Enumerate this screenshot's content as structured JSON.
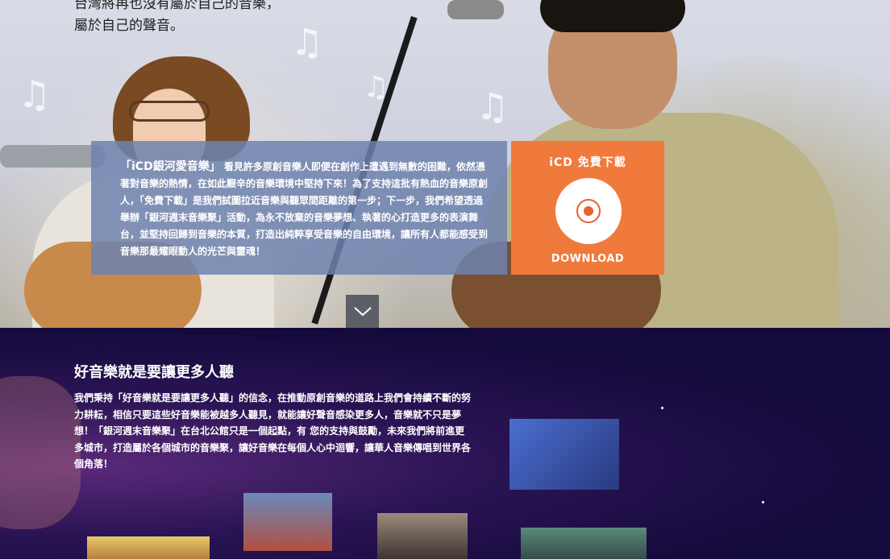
{
  "hero": {
    "text_line1": "台灣將再也沒有屬於自己的音樂，",
    "text_line2": "屬於自己的聲音。",
    "info_lead": "「iCD銀河愛音樂」",
    "info_body": "看見許多原創音樂人即便在創作上遭遇到無數的困難，依然憑著對音樂的熱情，在如此艱辛的音樂環境中堅持下來！為了支持這批有熱血的音樂原創人，「免費下載」是我們試圖拉近音樂與聽眾間距離的第一步；下一步，我們希望透過舉辦「銀河週末音樂聚」活動，為永不放棄的音樂夢想、執著的心打造更多的表演舞台，並堅持回歸到音樂的本質，打造出純粹享受音樂的自由環境，讓所有人都能感受到音樂那最耀眼動人的光芒與靈魂！",
    "download_title": "iCD 免費下載",
    "download_label": "DOWNLOAD",
    "music_note_glyph": "♫"
  },
  "section": {
    "title": "好音樂就是要讓更多人聽",
    "body": "我們秉持「好音樂就是要讓更多人聽」的信念，在推動原創音樂的道路上我們會持續不斷的努力耕耘，相信只要這些好音樂能被越多人聽見，就能讓好聲音感染更多人，音樂就不只是夢想！「銀河週末音樂聚」在台北公館只是一個起點，有 您的支持與鼓勵，未來我們將前進更多城市，打造屬於各個城市的音樂聚，讓好音樂在每個人心中迴響，讓華人音樂傳唱到世界各個角落！"
  },
  "colors": {
    "info_box": "#6e82af",
    "download_orange": "#f07a3c",
    "scroll_button": "#5d5f66",
    "lower_background": "#150a3c"
  },
  "icons": {
    "scroll": "chevron-down-icon",
    "disc": "cd-disc-icon",
    "notes": "music-note-icon"
  }
}
